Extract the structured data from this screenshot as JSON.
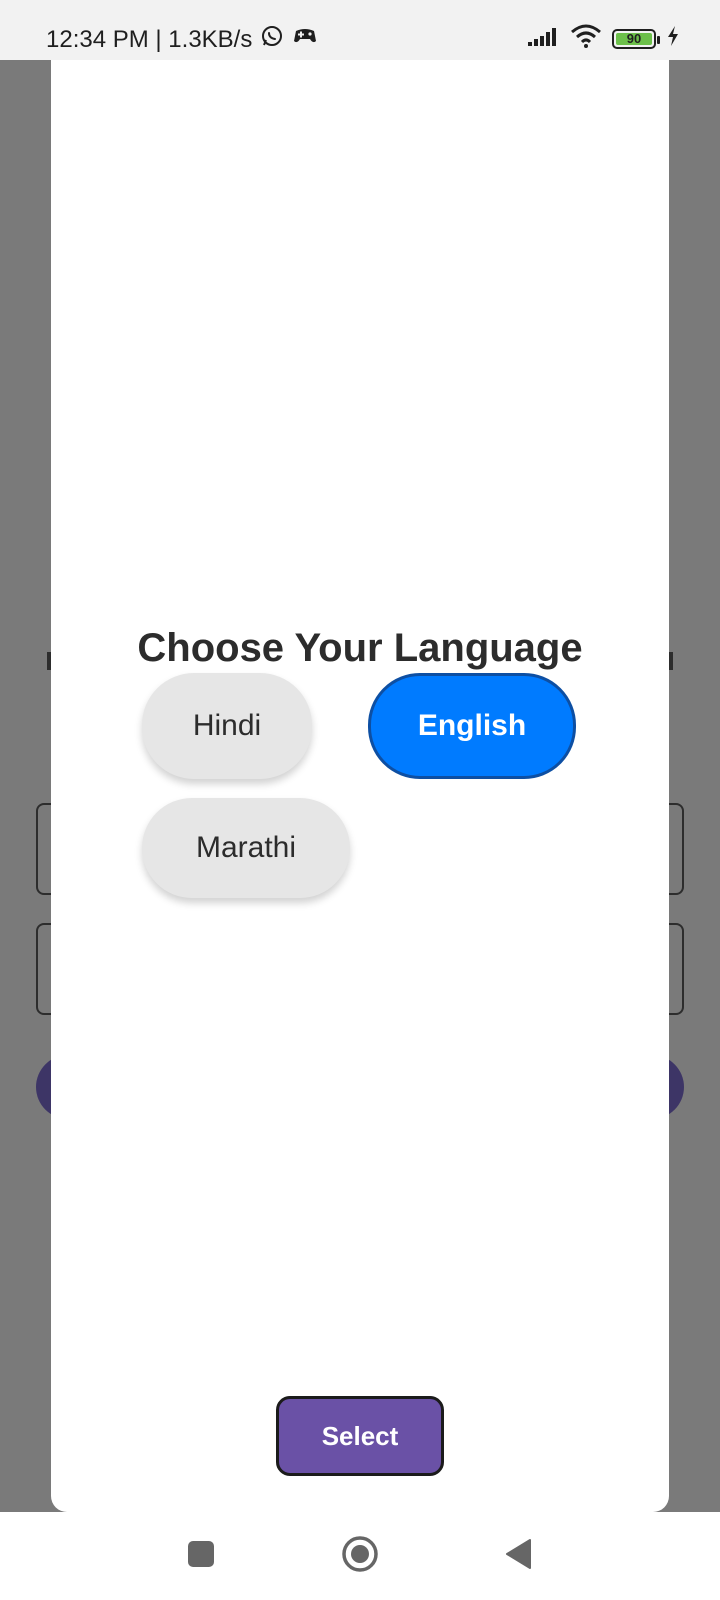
{
  "status_bar": {
    "time_speed": "12:34 PM | 1.3KB/s",
    "battery_level": "90",
    "icons": [
      "whatsapp-icon",
      "game-controller-icon",
      "signal-icon",
      "wifi-icon",
      "battery-icon",
      "charging-icon"
    ]
  },
  "dialog": {
    "title": "Choose Your Language",
    "languages": [
      {
        "label": "Hindi",
        "selected": false
      },
      {
        "label": "English",
        "selected": true
      },
      {
        "label": "Marathi",
        "selected": false
      }
    ],
    "select_label": "Select"
  },
  "nav_bar": {
    "icons": [
      "recents-square-icon",
      "home-circle-icon",
      "back-triangle-icon"
    ]
  },
  "colors": {
    "accent_selected": "#007bff",
    "select_button": "#6a51a6",
    "overlay": "#7a7a7a"
  }
}
